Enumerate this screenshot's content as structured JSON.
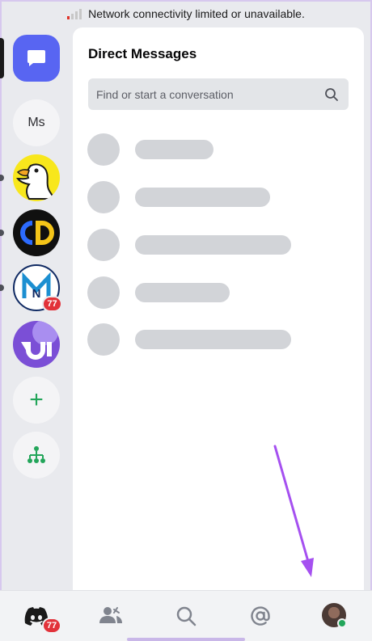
{
  "status_bar": {
    "message": "Network connectivity limited or unavailable.",
    "signal_icon": "signal-bars-icon"
  },
  "guild_rail": {
    "items": [
      {
        "name": "direct-messages",
        "icon": "chat-bubble-icon",
        "selected": true
      },
      {
        "name": "server-ms",
        "label": "Ms"
      },
      {
        "name": "server-duck",
        "icon": "duck-icon",
        "unread": true
      },
      {
        "name": "server-cd",
        "label": "CD",
        "unread": true
      },
      {
        "name": "server-mn",
        "label": "N",
        "unread": true,
        "badge": "77"
      },
      {
        "name": "server-purple",
        "icon": "abstract-logo-icon"
      },
      {
        "name": "add-server",
        "label": "+",
        "icon": "plus-icon"
      },
      {
        "name": "explore-servers",
        "icon": "hierarchy-icon"
      }
    ]
  },
  "panel": {
    "title": "Direct Messages",
    "search": {
      "placeholder": "Find or start a conversation",
      "value": "",
      "icon": "search-icon"
    }
  },
  "bottom_nav": {
    "items": [
      {
        "name": "home",
        "icon": "discord-logo-icon",
        "badge": "77"
      },
      {
        "name": "friends",
        "icon": "friends-icon"
      },
      {
        "name": "search",
        "icon": "search-icon"
      },
      {
        "name": "mentions",
        "icon": "at-sign-icon"
      },
      {
        "name": "profile",
        "icon": "avatar",
        "status": "online"
      }
    ]
  },
  "colors": {
    "accent": "#5865f2",
    "badge": "#e2323a",
    "online": "#23a55a",
    "annotation_arrow": "#a550f0"
  }
}
